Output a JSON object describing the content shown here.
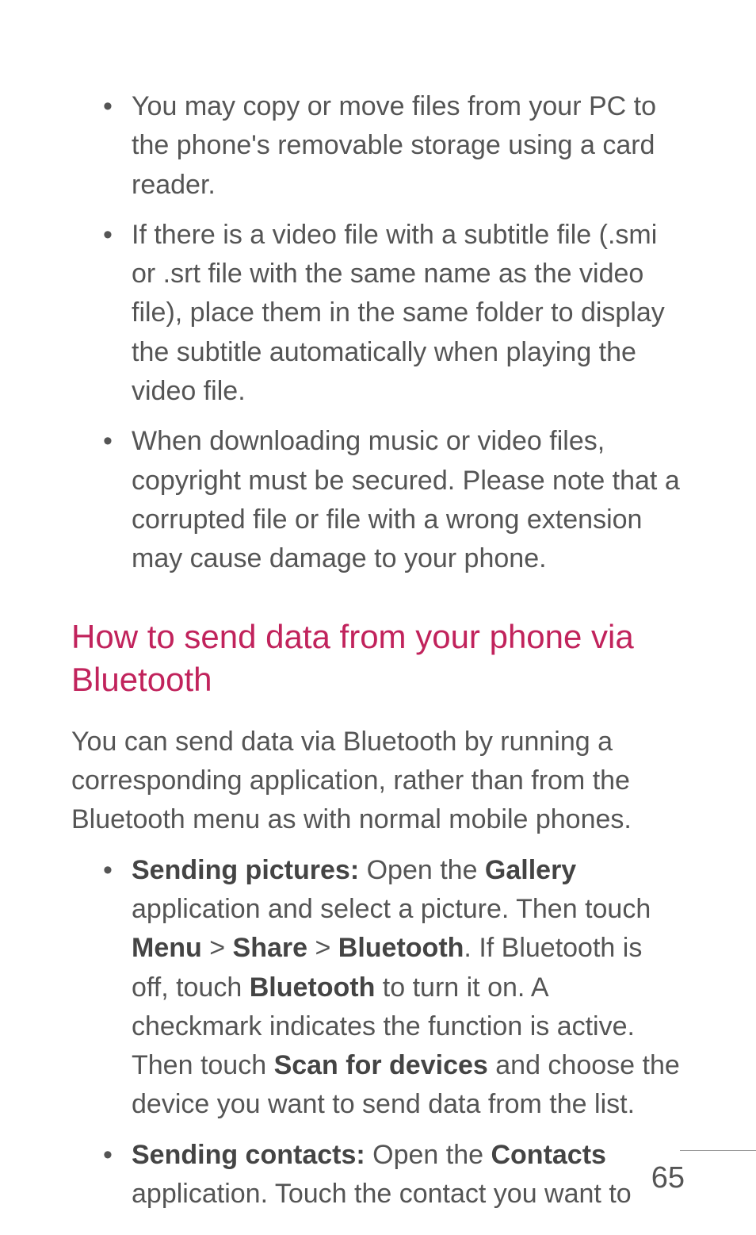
{
  "bullets_top": [
    "You may copy or move files from your PC to the phone's removable storage using a card reader.",
    "If there is a video file with a subtitle file (.smi or .srt file with the same name as the video file), place them in the same folder to display the subtitle automatically when playing the video file.",
    "When downloading music or video files, copyright must be secured. Please note that a corrupted file or file with a wrong extension may cause damage to your phone."
  ],
  "heading": "How to send data from your phone via Bluetooth",
  "intro_para": "You can send data via Bluetooth by running a corresponding application, rather than from the Bluetooth menu as with normal mobile phones.",
  "bullets_bottom": [
    {
      "lead_bold": "Sending pictures:",
      "segments": [
        {
          "t": " Open the "
        },
        {
          "t": "Gallery",
          "b": true
        },
        {
          "t": " application and select a picture. Then touch "
        },
        {
          "t": "Menu",
          "b": true
        },
        {
          "t": " > "
        },
        {
          "t": "Share",
          "b": true
        },
        {
          "t": " > "
        },
        {
          "t": "Bluetooth",
          "b": true
        },
        {
          "t": ". If Bluetooth is off, touch "
        },
        {
          "t": "Bluetooth",
          "b": true
        },
        {
          "t": " to turn it on. A checkmark indicates the function is active. Then touch "
        },
        {
          "t": "Scan for devices",
          "b": true
        },
        {
          "t": " and choose the device you want to send data from the list."
        }
      ]
    },
    {
      "lead_bold": "Sending contacts:",
      "segments": [
        {
          "t": " Open the "
        },
        {
          "t": "Contacts",
          "b": true
        },
        {
          "t": " application. Touch the contact you want to"
        }
      ]
    }
  ],
  "page_number": "65"
}
